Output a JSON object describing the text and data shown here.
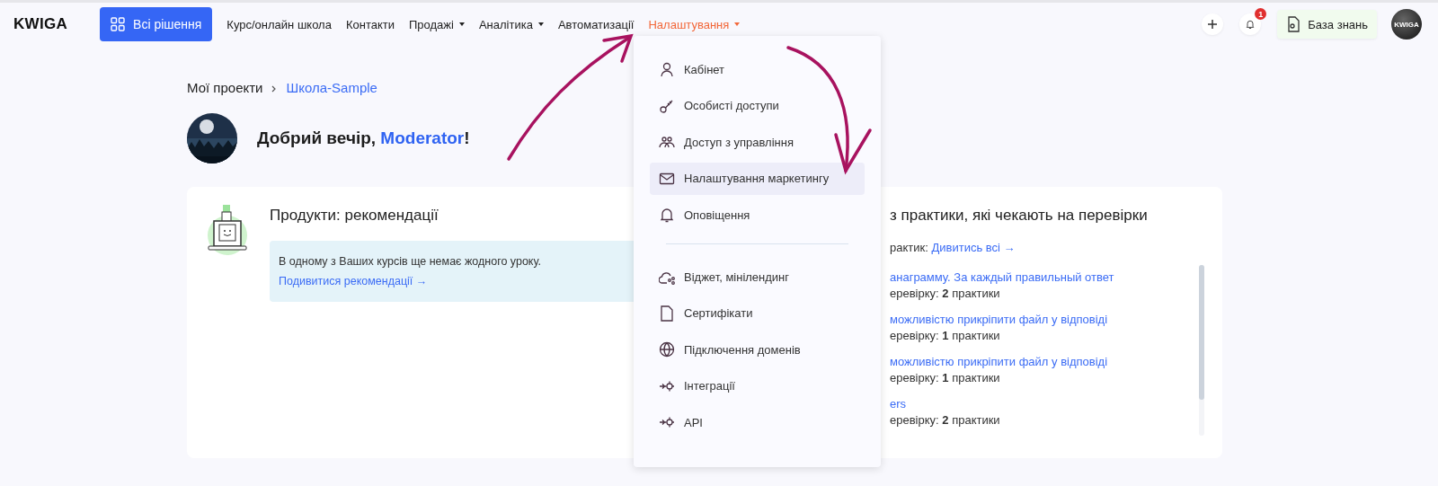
{
  "brand": "KWIGA",
  "nav": {
    "solutions_button": "Всі рішення",
    "items": [
      {
        "label": "Курс/онлайн школа",
        "dropdown": false,
        "selected": false
      },
      {
        "label": "Контакти",
        "dropdown": false,
        "selected": false
      },
      {
        "label": "Продажі",
        "dropdown": true,
        "selected": false
      },
      {
        "label": "Аналітика",
        "dropdown": true,
        "selected": false
      },
      {
        "label": "Автоматизації",
        "dropdown": false,
        "selected": false
      },
      {
        "label": "Налаштування",
        "dropdown": true,
        "selected": true
      }
    ]
  },
  "header_actions": {
    "notifications_count": "1",
    "knowledge_base": "База знань",
    "avatar_text": "KWIGA"
  },
  "breadcrumbs": [
    {
      "label": "Мої проекти",
      "link": false
    },
    {
      "label": "Школа-Sample",
      "link": true
    }
  ],
  "greeting": {
    "text": "Добрий вечір, ",
    "name": "Moderator",
    "suffix": "!"
  },
  "recommendations": {
    "title": "Продукти: рекомендації",
    "notice": "В одному з Ваших курсів ще немає жодного уроку.",
    "link": "Подивитися рекомендації →"
  },
  "practices": {
    "title": "з практики, які чекають на перевірки",
    "count_label": "рактик:",
    "view_all": "Дивитись всі →",
    "items": [
      {
        "title": "анаграмму. За каждый правильный ответ",
        "pending": "еревірку: **2** практики"
      },
      {
        "title": "можливістю прикріпити файл у відповіді",
        "pending": "еревірку: **1** практики"
      },
      {
        "title": "можливістю прикріпити файл у відповіді",
        "pending": "еревірку: **1** практики"
      },
      {
        "title": "ers",
        "pending": "еревірку: **2** практики"
      }
    ]
  },
  "settings_menu": {
    "groups": [
      [
        {
          "label": "Кабінет",
          "selected": false
        },
        {
          "label": "Особисті доступи",
          "selected": false
        },
        {
          "label": "Доступ з управління",
          "selected": false
        },
        {
          "label": "Налаштування маркетингу",
          "selected": true
        },
        {
          "label": "Оповіщення",
          "selected": false
        }
      ],
      [
        {
          "label": "Віджет, мінілендинг",
          "selected": false
        },
        {
          "label": "Сертифікати",
          "selected": false
        },
        {
          "label": "Підключення доменів",
          "selected": false
        },
        {
          "label": "Інтеграції",
          "selected": false
        },
        {
          "label": "API",
          "selected": false
        }
      ]
    ]
  }
}
